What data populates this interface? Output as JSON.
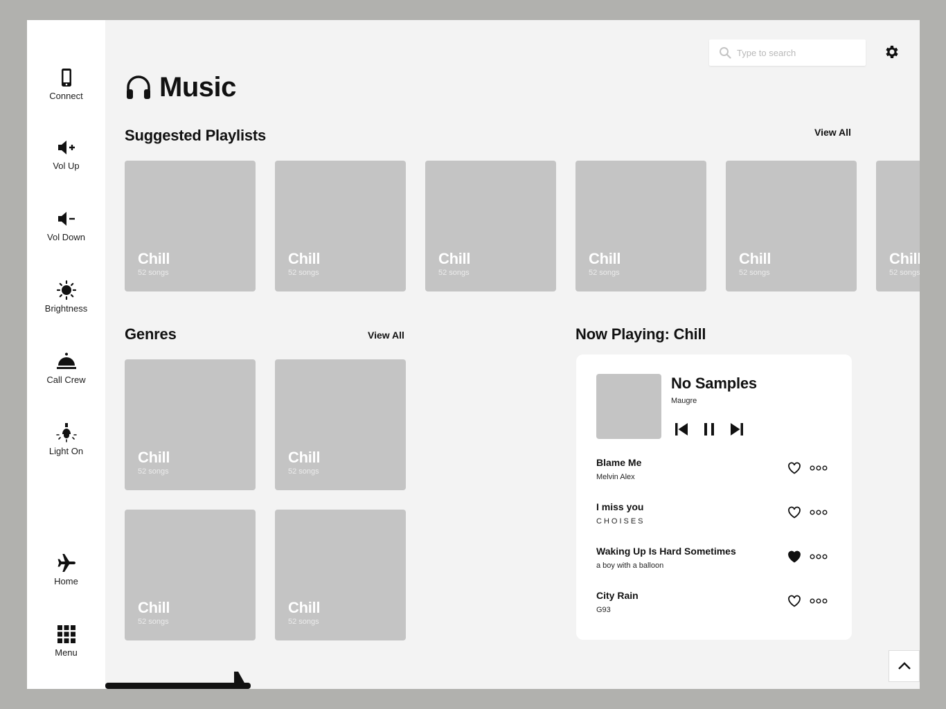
{
  "sidebar": {
    "items": [
      {
        "label": "Connect",
        "icon": "phone-icon"
      },
      {
        "label": "Vol Up",
        "icon": "volume-up-icon"
      },
      {
        "label": "Vol Down",
        "icon": "volume-down-icon"
      },
      {
        "label": "Brightness",
        "icon": "sun-icon"
      },
      {
        "label": "Call Crew",
        "icon": "service-bell-icon"
      },
      {
        "label": "Light On",
        "icon": "lamp-icon"
      },
      {
        "label": "Home",
        "icon": "airplane-icon"
      },
      {
        "label": "Menu",
        "icon": "grid-icon"
      }
    ]
  },
  "header": {
    "search_placeholder": "Type to search",
    "title": "Music"
  },
  "suggested": {
    "title": "Suggested Playlists",
    "view_all": "View All",
    "cards": [
      {
        "title": "Chill",
        "subtitle": "52 songs"
      },
      {
        "title": "Chill",
        "subtitle": "52 songs"
      },
      {
        "title": "Chill",
        "subtitle": "52 songs"
      },
      {
        "title": "Chill",
        "subtitle": "52 songs"
      },
      {
        "title": "Chill",
        "subtitle": "52 songs"
      },
      {
        "title": "Chill",
        "subtitle": "52 songs"
      }
    ]
  },
  "genres": {
    "title": "Genres",
    "view_all": "View All",
    "cards": [
      {
        "title": "Chill",
        "subtitle": "52 songs"
      },
      {
        "title": "Chill",
        "subtitle": "52 songs"
      },
      {
        "title": "Chill",
        "subtitle": "52 songs"
      },
      {
        "title": "Chill",
        "subtitle": "52 songs"
      }
    ]
  },
  "now_playing": {
    "title": "Now Playing: Chill",
    "track": "No Samples",
    "artist": "Maugre",
    "songs": [
      {
        "title": "Blame Me",
        "artist": "Melvin Alex",
        "liked": false
      },
      {
        "title": "I miss you",
        "artist": "CHOISES",
        "liked": false
      },
      {
        "title": "Waking Up Is Hard Sometimes",
        "artist": "a boy with a balloon",
        "liked": true
      },
      {
        "title": "City Rain",
        "artist": "G93",
        "liked": false
      }
    ]
  },
  "colors": {
    "background": "#f3f3f3",
    "outer": "#b1b1ae",
    "card": "#c4c4c4",
    "text": "#111111"
  }
}
